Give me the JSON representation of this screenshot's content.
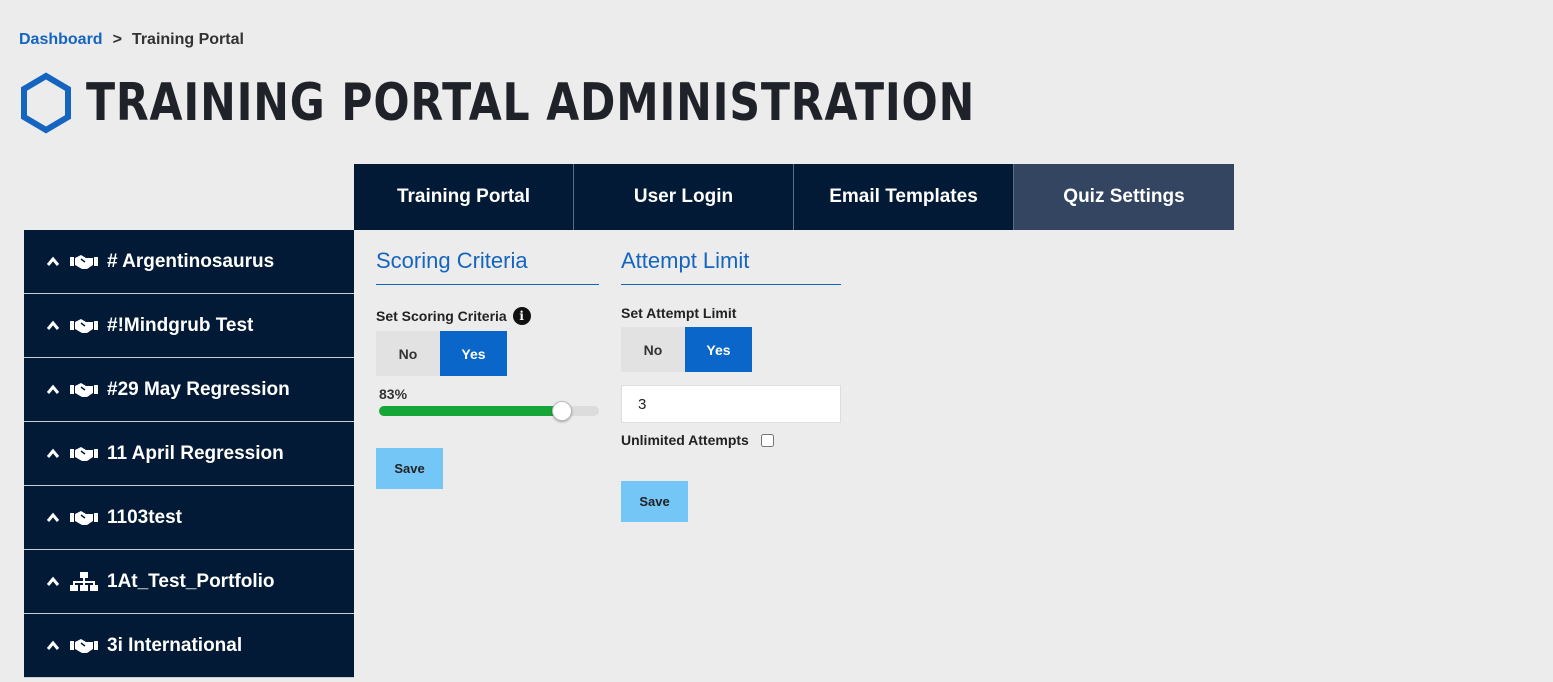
{
  "breadcrumb": {
    "link": "Dashboard",
    "separator": ">",
    "current": "Training Portal"
  },
  "page": {
    "title": "TRAINING PORTAL ADMINISTRATION",
    "logo_icon": "hexagon-icon",
    "accent_color": "#1565c0"
  },
  "tabs": [
    {
      "label": "Training Portal",
      "active": false
    },
    {
      "label": "User Login",
      "active": false
    },
    {
      "label": "Email Templates",
      "active": false
    },
    {
      "label": "Quiz Settings",
      "active": true
    }
  ],
  "sidebar": {
    "items": [
      {
        "label": "# Argentinosaurus",
        "icon": "handshake-icon"
      },
      {
        "label": "#!Mindgrub Test",
        "icon": "handshake-icon"
      },
      {
        "label": "#29 May Regression",
        "icon": "handshake-icon"
      },
      {
        "label": "11 April Regression",
        "icon": "handshake-icon"
      },
      {
        "label": "1103test",
        "icon": "handshake-icon"
      },
      {
        "label": "1At_Test_Portfolio",
        "icon": "org-chart-icon"
      },
      {
        "label": "3i International",
        "icon": "handshake-icon"
      }
    ]
  },
  "scoring": {
    "title": "Scoring Criteria",
    "label": "Set Scoring Criteria",
    "no_label": "No",
    "yes_label": "Yes",
    "selected": "Yes",
    "value_text": "83%",
    "value": 83,
    "save_label": "Save"
  },
  "attempts": {
    "title": "Attempt Limit",
    "label": "Set Attempt Limit",
    "no_label": "No",
    "yes_label": "Yes",
    "selected": "Yes",
    "limit_value": "3",
    "unlimited_label": "Unlimited Attempts",
    "unlimited_checked": false,
    "save_label": "Save"
  }
}
